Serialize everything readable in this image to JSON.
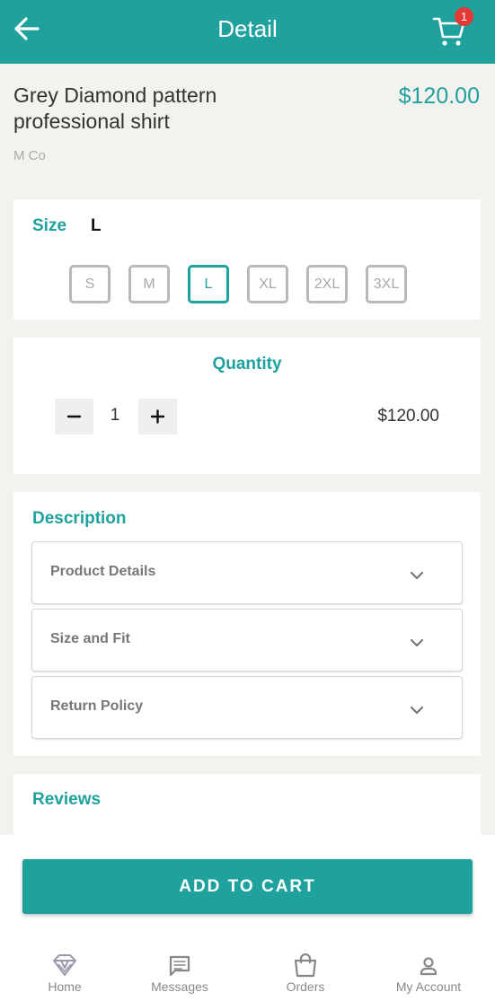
{
  "header": {
    "title": "Detail",
    "cart_count": "1",
    "back_icon": "arrow-left-icon",
    "cart_icon": "shopping-cart-icon"
  },
  "product": {
    "name": "Grey Diamond pattern professional shirt",
    "price": "$120.00",
    "brand": "M Co"
  },
  "size": {
    "label": "Size",
    "selected": "L",
    "options": [
      "S",
      "M",
      "L",
      "XL",
      "2XL",
      "3XL"
    ]
  },
  "quantity": {
    "title": "Quantity",
    "value": "1",
    "total": "$120.00"
  },
  "description": {
    "title": "Description",
    "sections": [
      "Product Details",
      "Size and Fit",
      "Return Policy"
    ]
  },
  "reviews": {
    "title": "Reviews"
  },
  "actions": {
    "add_to_cart": "ADD TO CART"
  },
  "bottom_nav": {
    "items": [
      {
        "label": "Home",
        "icon": "diamond-home-icon"
      },
      {
        "label": "Messages",
        "icon": "message-icon"
      },
      {
        "label": "Orders",
        "icon": "shopping-bag-icon"
      },
      {
        "label": "My Account",
        "icon": "user-icon"
      }
    ]
  },
  "colors": {
    "accent": "#1fa19d",
    "badge": "#e53935"
  }
}
